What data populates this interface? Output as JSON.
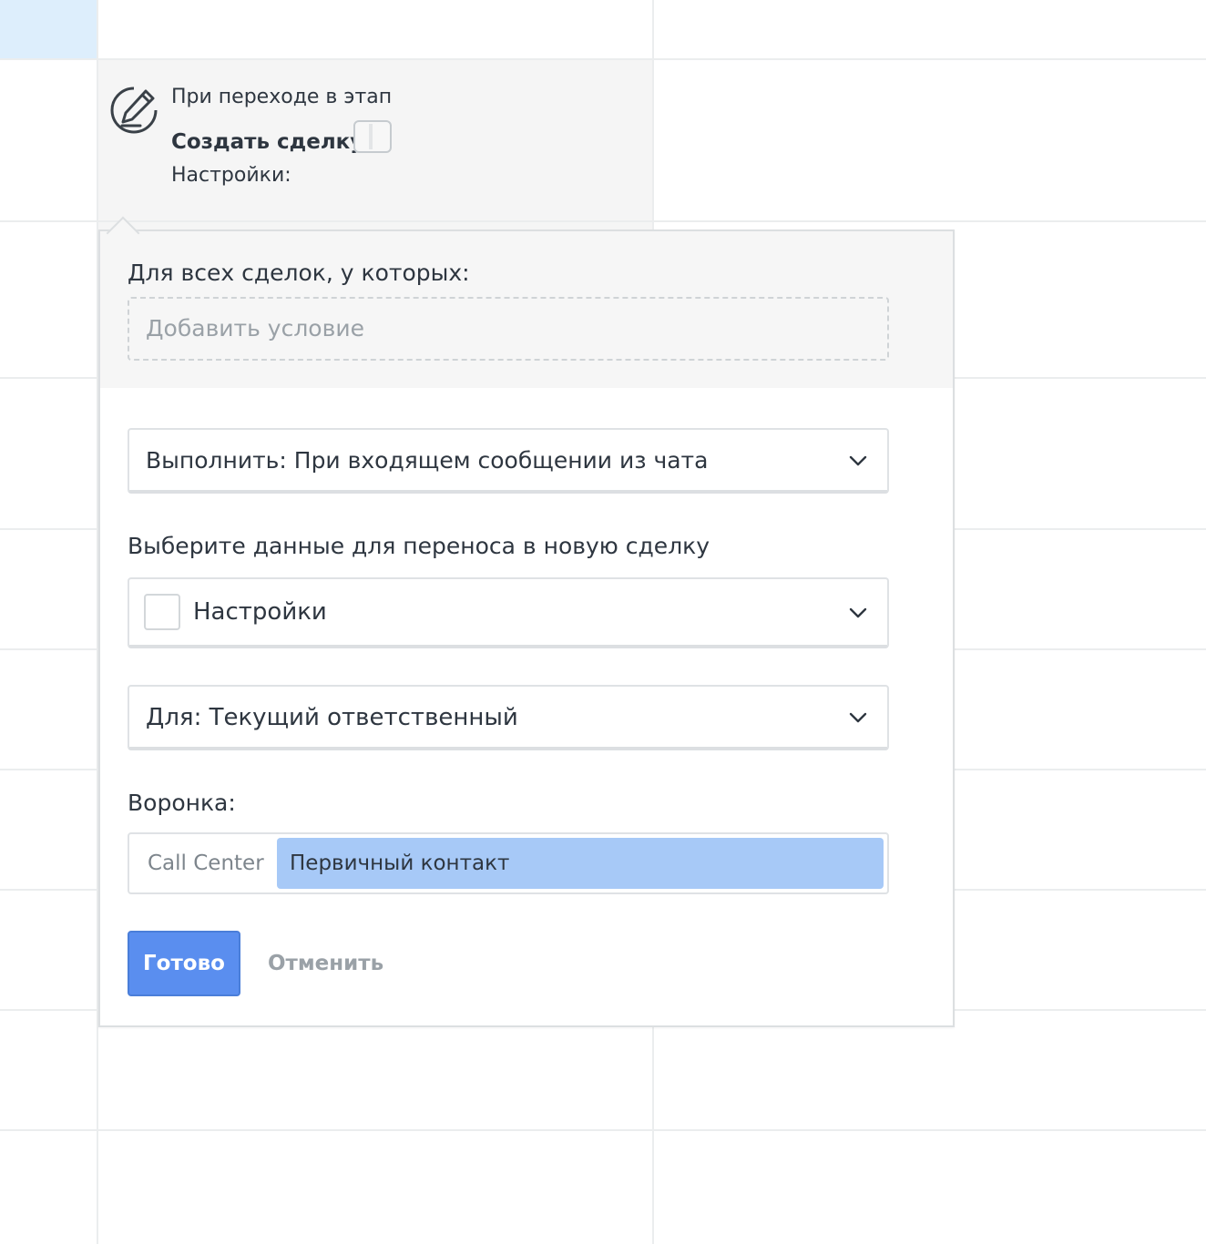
{
  "trigger": {
    "title": "При переходе в этап",
    "create_label": "Создать сделку:",
    "settings_label": "Настройки:",
    "icon": "pencil-edit-icon"
  },
  "popup": {
    "condition_label": "Для всех сделок, у которых:",
    "add_condition_placeholder": "Добавить условие",
    "execute_select": "Выполнить: При входящем сообщении из чата",
    "transfer_label": "Выберите данные для переноса в новую сделку",
    "settings_select": "Настройки",
    "for_select": "Для: Текущий ответственный",
    "funnel_label": "Воронка:",
    "funnel_pipeline": "Call Center",
    "funnel_stage": "Первичный контакт",
    "done_label": "Готово",
    "cancel_label": "Отменить"
  },
  "colors": {
    "accent_blue": "#5a8eef",
    "stage_highlight": "#a7c9f7",
    "grid_accent": "#ddeefc"
  }
}
